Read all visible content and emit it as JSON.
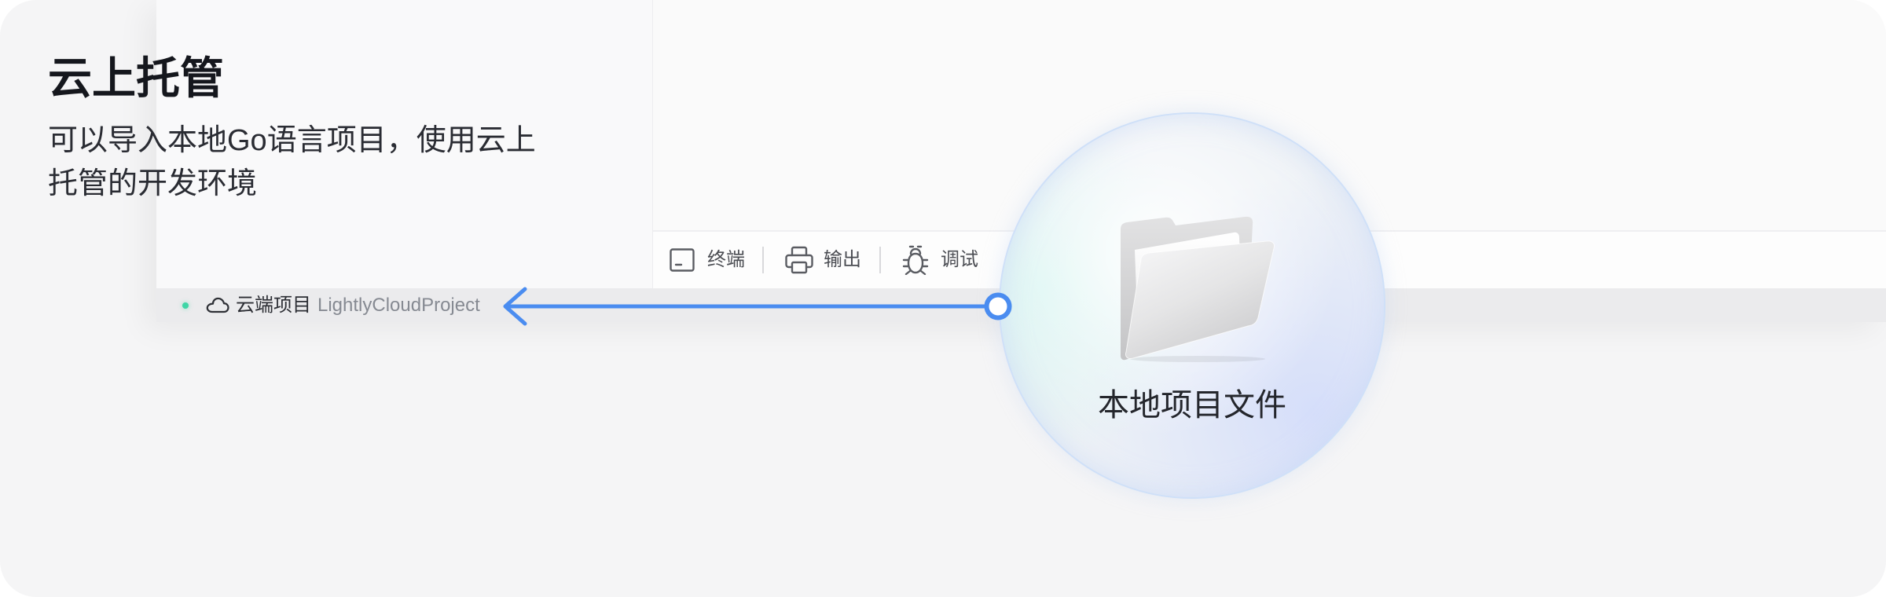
{
  "hero": {
    "title": "云上托管",
    "subtitle": [
      "可以导入本地Go语言项目，使用云上",
      "托管的开发环境"
    ]
  },
  "ide": {
    "panel_tabs": [
      {
        "label": "终端",
        "icon": "terminal-icon"
      },
      {
        "label": "输出",
        "icon": "printer-icon"
      },
      {
        "label": "调试",
        "icon": "bug-icon"
      }
    ],
    "status_bar": {
      "status_indicator_color": "#3dd6a6",
      "icon": "cloud-icon",
      "project_type": "云端项目",
      "project_name": "LightlyCloudProject"
    }
  },
  "import_flow": {
    "arrow_color": "#4a8cf0",
    "source": {
      "icon": "folder-icon",
      "label": "本地项目文件"
    }
  },
  "colors": {
    "card_background": "#f5f5f6",
    "title_text": "#15171d",
    "body_text": "#2a2c33",
    "muted_text": "#868a92",
    "accent": "#4a8cf0",
    "bubble_border": "#cfe0f8"
  }
}
